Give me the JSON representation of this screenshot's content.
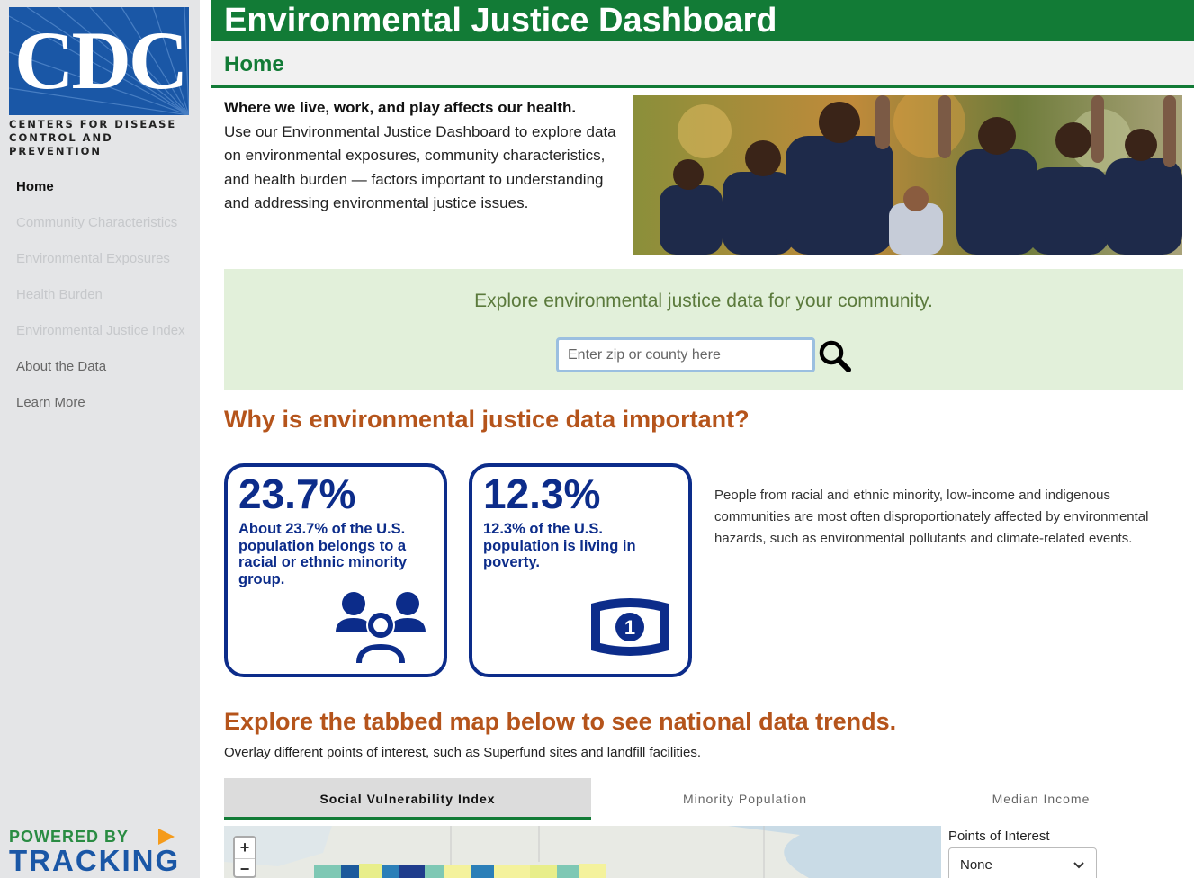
{
  "header": {
    "title": "Environmental Justice Dashboard",
    "page_title": "Home"
  },
  "logo": {
    "letters": "CDC",
    "line1": "Centers for Disease",
    "line2": "Control and Prevention"
  },
  "sidebar": {
    "items": [
      {
        "label": "Home",
        "state": "active"
      },
      {
        "label": "Community Characteristics",
        "state": "disabled"
      },
      {
        "label": "Environmental Exposures",
        "state": "disabled"
      },
      {
        "label": "Health Burden",
        "state": "disabled"
      },
      {
        "label": "Environmental Justice Index",
        "state": "disabled"
      },
      {
        "label": "About the Data",
        "state": "enabled"
      },
      {
        "label": "Learn More",
        "state": "enabled"
      }
    ],
    "powered_by": "POWERED BY",
    "tracking": "TRACKING"
  },
  "intro": {
    "lead": "Where we live, work, and play affects our health.",
    "body": "Use our Environmental Justice Dashboard to explore data on environmental exposures, community characteristics, and health burden — factors important to understanding and addressing environmental justice issues."
  },
  "search": {
    "prompt": "Explore environmental justice data for your community.",
    "placeholder": "Enter zip or county here",
    "value": ""
  },
  "why": {
    "heading": "Why is environmental justice data important?",
    "cards": [
      {
        "big": "23.7%",
        "desc": "About 23.7% of the U.S. population belongs to a racial or ethnic minority group.",
        "icon": "people-group-icon"
      },
      {
        "big": "12.3%",
        "desc": "12.3% of the U.S. population is living in poverty.",
        "icon": "dollar-bill-icon"
      }
    ],
    "text": "People from racial and ethnic minority, low-income and indigenous communities are most often disproportionately affected by environmental hazards, such as environmental pollutants and climate-related events."
  },
  "explore": {
    "heading": "Explore the tabbed map below to see national data trends.",
    "subheading": "Overlay different points of interest, such as Superfund sites and landfill facilities.",
    "tabs": [
      {
        "label": "Social Vulnerability Index",
        "active": true
      },
      {
        "label": "Minority Population",
        "active": false
      },
      {
        "label": "Median Income",
        "active": false
      }
    ],
    "zoom_in": "+",
    "zoom_out": "−",
    "poi_label": "Points of Interest",
    "poi_selected": "None"
  },
  "colors": {
    "green": "#127b36",
    "orange_heading": "#b5541b",
    "navy": "#0c2c8a",
    "search_band": "#e2f0da"
  }
}
